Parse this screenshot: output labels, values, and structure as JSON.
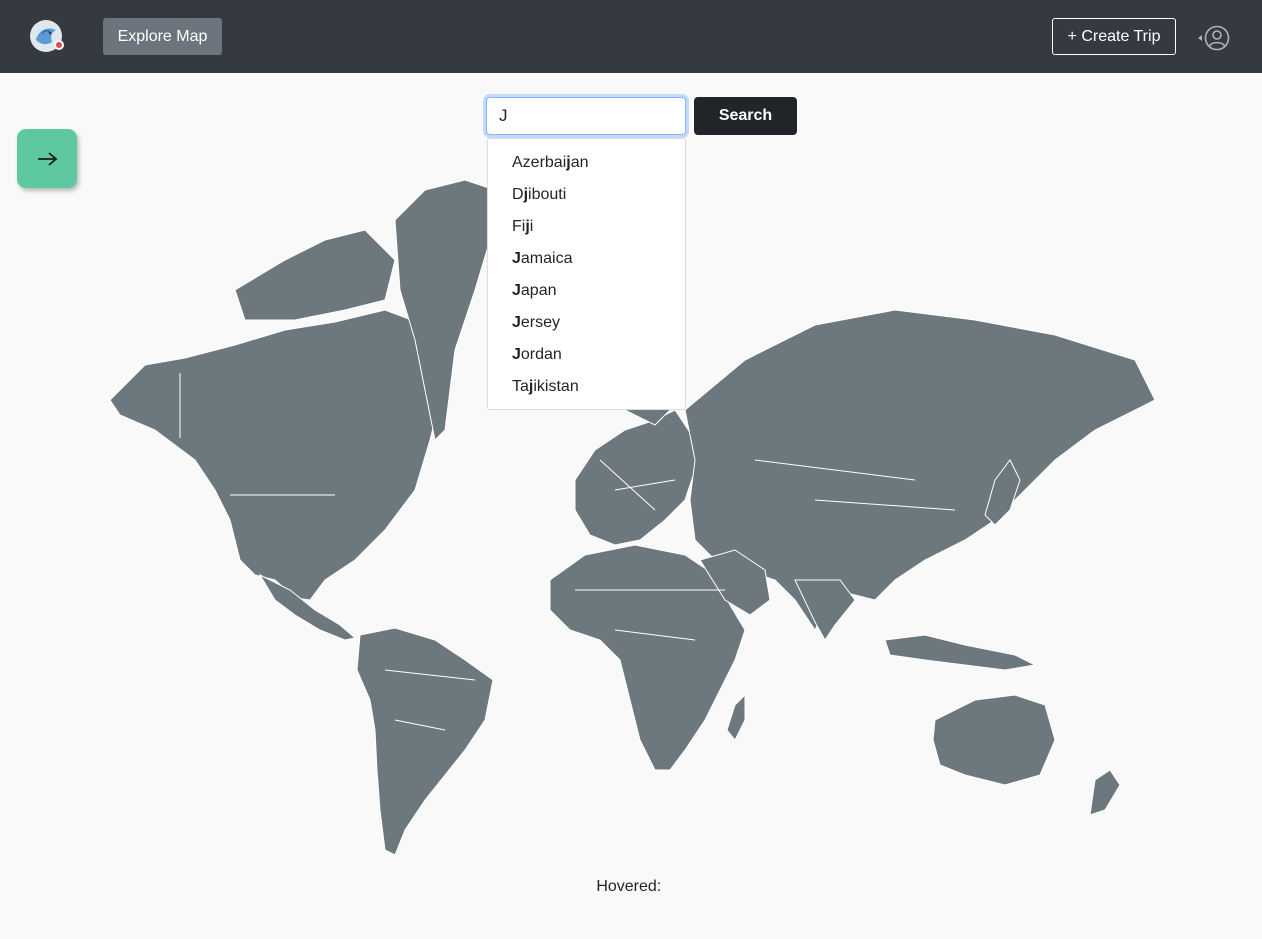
{
  "navbar": {
    "explore_label": "Explore Map",
    "create_trip_label": "+ Create Trip",
    "icons": {
      "logo": "bird-logo-icon",
      "user": "user-circle-icon"
    },
    "colors": {
      "background": "#343a40",
      "explore_bg": "#6c757d"
    }
  },
  "search": {
    "value": "J",
    "button_label": "Search",
    "suggestions": [
      {
        "before": "Azerbai",
        "match": "j",
        "after": "an"
      },
      {
        "before": "D",
        "match": "j",
        "after": "ibouti"
      },
      {
        "before": "Fi",
        "match": "j",
        "after": "i"
      },
      {
        "before": "",
        "match": "J",
        "after": "amaica"
      },
      {
        "before": "",
        "match": "J",
        "after": "apan"
      },
      {
        "before": "",
        "match": "J",
        "after": "ersey"
      },
      {
        "before": "",
        "match": "J",
        "after": "ordan"
      },
      {
        "before": "Ta",
        "match": "j",
        "after": "ikistan"
      }
    ]
  },
  "sidebar_toggle": {
    "icon": "arrow-right-icon",
    "color": "#5ec9a0"
  },
  "map": {
    "land_color": "#6c787e",
    "border_color": "#ffffff"
  },
  "hovered": {
    "label": "Hovered:",
    "value": ""
  }
}
